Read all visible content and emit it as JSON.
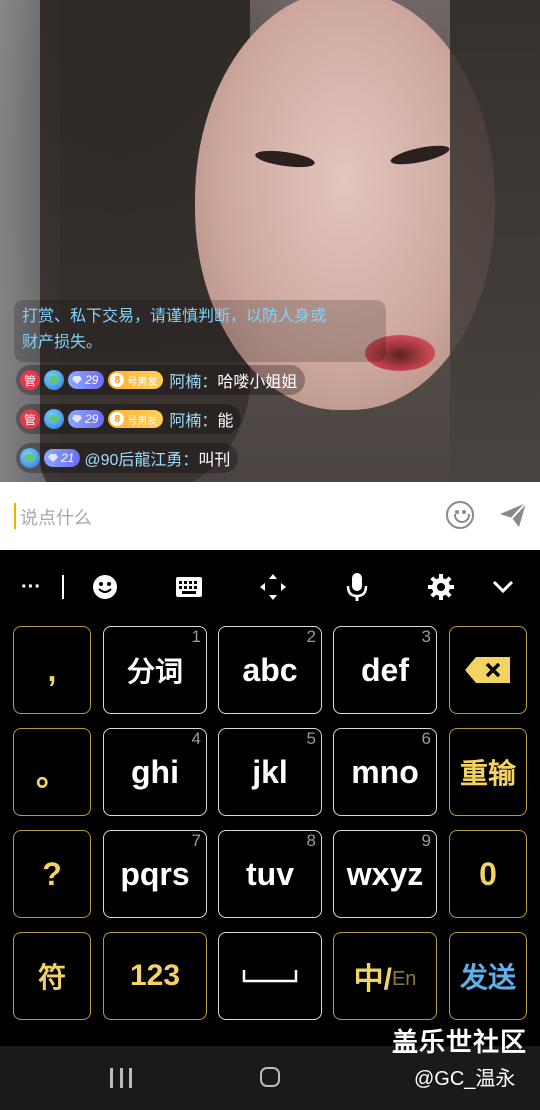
{
  "live": {
    "notice_line1": "打赏、私下交易，请谨慎判断，以防人身或",
    "notice_line2": "财产损失。",
    "messages": [
      {
        "guan": "管",
        "level": "29",
        "bf_num": "8",
        "bf_label": "号男友",
        "name": "阿楠",
        "sep": "：",
        "text": "哈喽小姐姐"
      },
      {
        "guan": "管",
        "level": "29",
        "bf_num": "8",
        "bf_label": "号男友",
        "name": "阿楠",
        "sep": "：",
        "text": "能"
      },
      {
        "level": "21",
        "name": "@90后龍江勇",
        "sep": "：",
        "text": "叫刊"
      }
    ]
  },
  "input": {
    "placeholder": "说点什么",
    "emoji_icon": "emoji-icon",
    "send_icon": "send-icon"
  },
  "toolbar": {
    "more": "···",
    "items": [
      "emoji-icon",
      "keyboard-icon",
      "cursor-move-icon",
      "mic-icon",
      "gear-icon",
      "chevron-down-icon"
    ]
  },
  "keyboard": {
    "left": [
      ",",
      "。",
      "?",
      "符"
    ],
    "grid": [
      {
        "label": "分词",
        "num": "1"
      },
      {
        "label": "abc",
        "num": "2"
      },
      {
        "label": "def",
        "num": "3"
      },
      {
        "label": "ghi",
        "num": "4"
      },
      {
        "label": "jkl",
        "num": "5"
      },
      {
        "label": "mno",
        "num": "6"
      },
      {
        "label": "pqrs",
        "num": "7"
      },
      {
        "label": "tuv",
        "num": "8"
      },
      {
        "label": "wxyz",
        "num": "9"
      }
    ],
    "right": {
      "reinput": "重输",
      "zero": "0",
      "send": "发送"
    },
    "bottom": {
      "num123": "123",
      "zh": "中/",
      "en": "En"
    },
    "colors": {
      "gold": "#f3d463",
      "send": "#5fb0e8",
      "border": "#d9d9d9"
    }
  },
  "watermark": {
    "line1": "盖乐世社区",
    "line2": "@GC_温永"
  },
  "nav": {
    "items": [
      "recents-icon",
      "home-icon"
    ]
  }
}
